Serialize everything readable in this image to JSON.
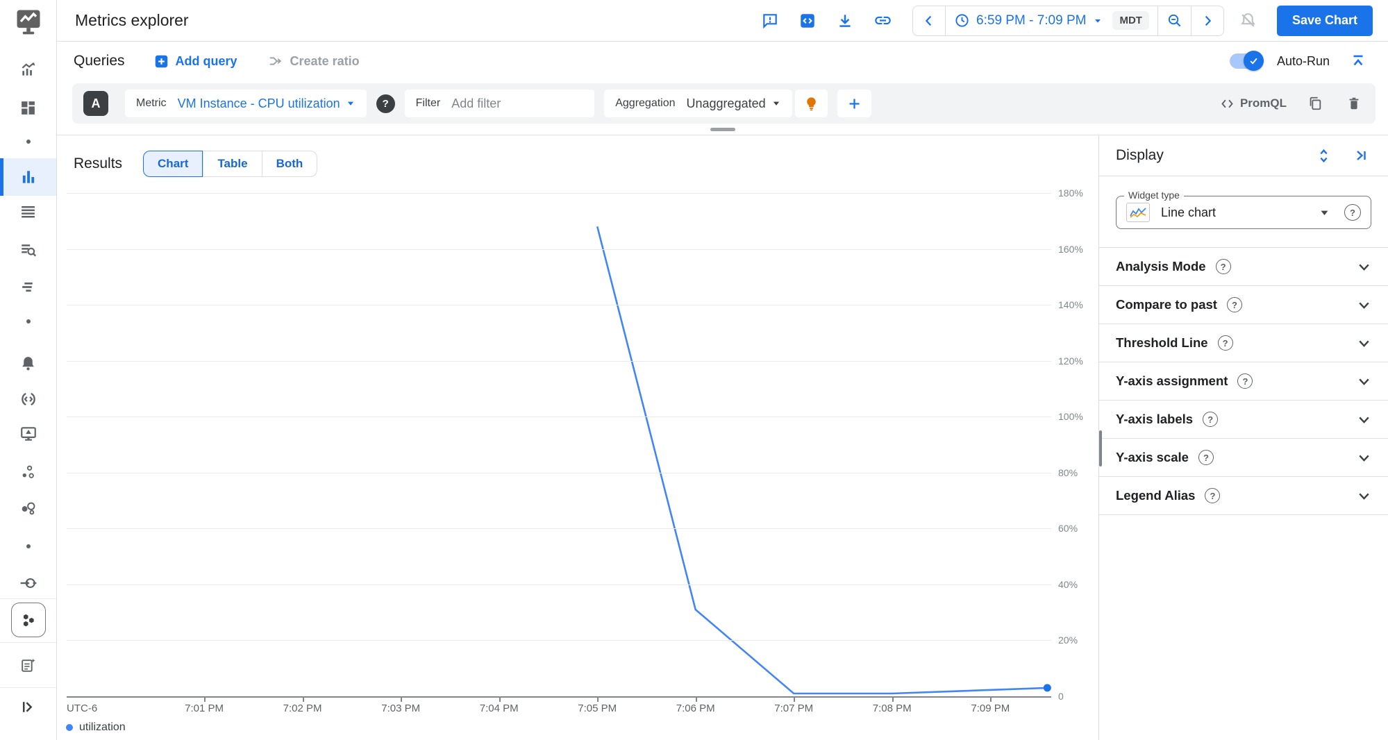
{
  "colors": {
    "accent": "#1a73e8",
    "chart_line": "#4285f4",
    "selected_bg": "#e8f0fe",
    "row_bg": "#f1f3f4",
    "text_dark": "#202124",
    "text_gray": "#5f6368",
    "lightbulb_orange": "#e37400"
  },
  "header": {
    "title": "Metrics explorer",
    "time_range": "6:59 PM - 7:09 PM",
    "timezone": "MDT",
    "save_button": "Save Chart"
  },
  "queries_bar": {
    "title": "Queries",
    "add_query": "Add query",
    "create_ratio": "Create ratio",
    "auto_run": "Auto-Run"
  },
  "query_builder": {
    "query_letter": "A",
    "metric_label": "Metric",
    "metric_value": "VM Instance - CPU utilization",
    "help_glyph": "?",
    "filter_label": "Filter",
    "filter_placeholder": "Add filter",
    "aggregation_label": "Aggregation",
    "aggregation_value": "Unaggregated",
    "promql_label": "PromQL"
  },
  "results": {
    "title": "Results",
    "tabs": [
      "Chart",
      "Table",
      "Both"
    ],
    "selected_tab": "Chart"
  },
  "display_panel": {
    "title": "Display",
    "widget_type_label": "Widget type",
    "widget_type_value": "Line chart",
    "help_glyph": "?",
    "sections": [
      "Analysis Mode",
      "Compare to past",
      "Threshold Line",
      "Y-axis assignment",
      "Y-axis labels",
      "Y-axis scale",
      "Legend Alias"
    ]
  },
  "chart_data": {
    "type": "line",
    "title": "",
    "timezone_label": "UTC-6",
    "grid": true,
    "legend_position": "bottom-left",
    "ylim": [
      0,
      180
    ],
    "y_unit": "%",
    "y_gridlines": [
      {
        "value": 0,
        "label": "0"
      },
      {
        "value": 20,
        "label": "20%"
      },
      {
        "value": 40,
        "label": "40%"
      },
      {
        "value": 60,
        "label": "60%"
      },
      {
        "value": 80,
        "label": "80%"
      },
      {
        "value": 100,
        "label": "100%"
      },
      {
        "value": 120,
        "label": "120%"
      },
      {
        "value": 140,
        "label": "140%"
      },
      {
        "value": 160,
        "label": "160%"
      },
      {
        "value": 180,
        "label": "180%"
      }
    ],
    "x_domain_minutes": [
      -0.4,
      9.62
    ],
    "x_ticks": [
      {
        "label": "7:01 PM",
        "minutes": 1
      },
      {
        "label": "7:02 PM",
        "minutes": 2
      },
      {
        "label": "7:03 PM",
        "minutes": 3
      },
      {
        "label": "7:04 PM",
        "minutes": 4
      },
      {
        "label": "7:05 PM",
        "minutes": 5
      },
      {
        "label": "7:06 PM",
        "minutes": 6
      },
      {
        "label": "7:07 PM",
        "minutes": 7
      },
      {
        "label": "7:08 PM",
        "minutes": 8
      },
      {
        "label": "7:09 PM",
        "minutes": 9
      }
    ],
    "series": [
      {
        "name": "utilization",
        "color": "#4285f4",
        "endpoint_dot": true,
        "points": [
          {
            "time": "7:05 PM",
            "minutes": 5,
            "value": 168
          },
          {
            "time": "7:06 PM",
            "minutes": 6,
            "value": 31
          },
          {
            "time": "7:07 PM",
            "minutes": 7,
            "value": 1
          },
          {
            "time": "7:08 PM",
            "minutes": 8,
            "value": 1
          },
          {
            "time": "7:09:35 PM",
            "minutes": 9.58,
            "value": 3
          }
        ]
      }
    ]
  }
}
